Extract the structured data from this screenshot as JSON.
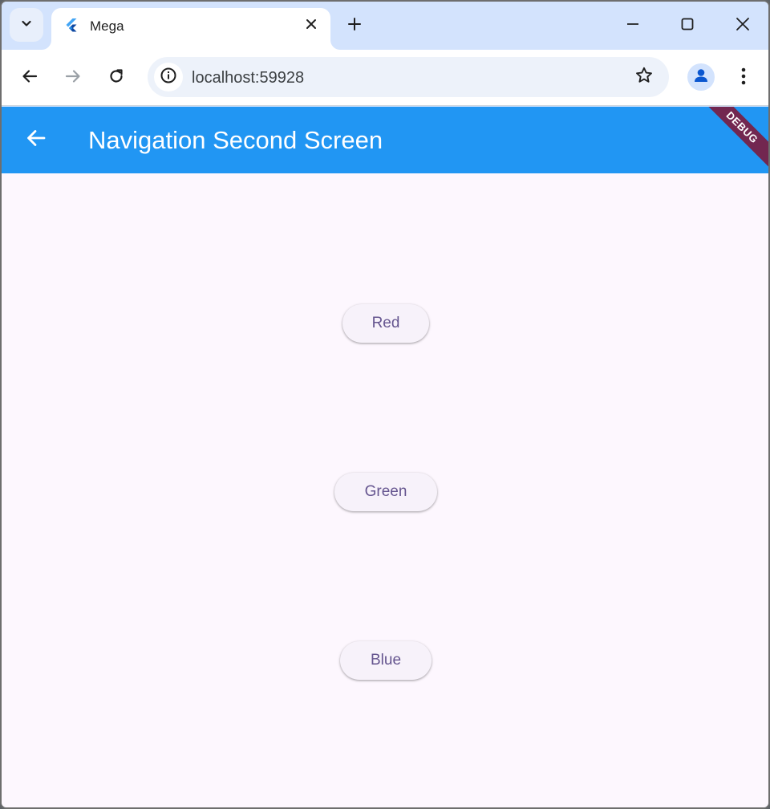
{
  "browser": {
    "tab_title": "Mega",
    "url": "localhost:59928",
    "icons": {
      "tab_search": "chevron-down-icon",
      "favicon": "flutter-icon",
      "tab_close": "close-icon",
      "new_tab": "plus-icon",
      "minimize": "minimize-icon",
      "maximize": "maximize-icon",
      "close": "close-icon",
      "back": "arrow-left-icon",
      "forward": "arrow-right-icon",
      "reload": "reload-icon",
      "site_info": "info-icon",
      "bookmark": "star-icon",
      "profile": "person-icon",
      "menu": "more-vert-icon"
    }
  },
  "app": {
    "title": "Navigation Second Screen",
    "debug_banner": "DEBUG",
    "buttons": [
      {
        "label": "Red"
      },
      {
        "label": "Green"
      },
      {
        "label": "Blue"
      }
    ],
    "colors": {
      "appbar": "#2196f3",
      "background": "#fdf7fe",
      "button_bg": "#f7f2fa",
      "button_text": "#65558f",
      "debug_banner": "#801432"
    }
  }
}
